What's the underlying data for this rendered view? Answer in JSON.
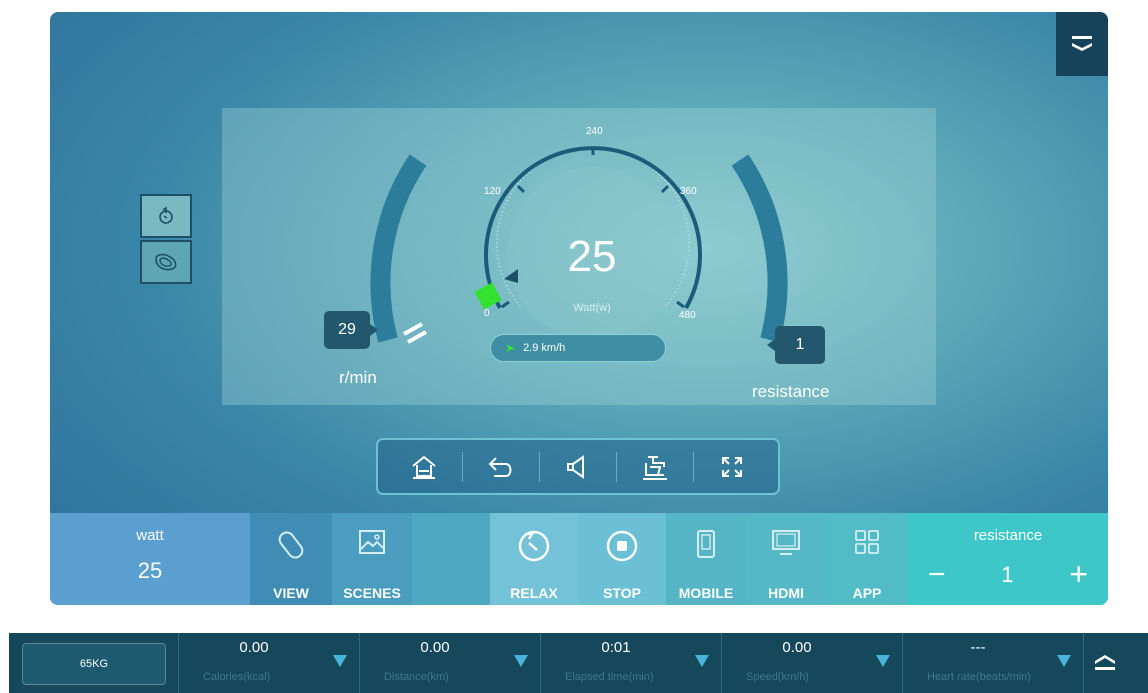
{
  "gauge": {
    "value": "25",
    "unit": "Watt(w)",
    "fill_fraction": 0.05,
    "ticks": [
      "0",
      "120",
      "240",
      "360",
      "480"
    ],
    "speed": "2.9 km/h"
  },
  "rpm": {
    "value": "29",
    "label": "r/min"
  },
  "resistance_display": {
    "value": "1",
    "label": "resistance"
  },
  "side_panel": [
    "route-icon",
    "track-icon"
  ],
  "control_bar": [
    "home-icon",
    "back-icon",
    "volume-icon",
    "bike-icon",
    "fullscreen-icon"
  ],
  "bottom_bar": {
    "watt_title": "watt",
    "watt_value": "25",
    "view": "VIEW",
    "scenes": "SCENES",
    "relax": "RELAX",
    "stop": "STOP",
    "mobile": "MOBILE",
    "hdmi": "HDMI",
    "app": "APP",
    "resistance_title": "resistance",
    "resistance_value": "1",
    "minus": "−",
    "plus": "+"
  },
  "stats": {
    "weight": "65KG",
    "items": [
      {
        "value": "0.00",
        "label": "Calories(kcal)"
      },
      {
        "value": "0.00",
        "label": "Distance(km)"
      },
      {
        "value": "0:01",
        "label": "Elapsed time(min)"
      },
      {
        "value": "0.00",
        "label": "Speed(km/h)"
      },
      {
        "value": "---",
        "label": "Heart rate(beats/min)"
      }
    ]
  },
  "colors": {
    "accent": "#3ec7c9",
    "panel_dark": "#15485b",
    "gauge_marker": "#31e22f",
    "watt_box": "#5a9fd0"
  }
}
